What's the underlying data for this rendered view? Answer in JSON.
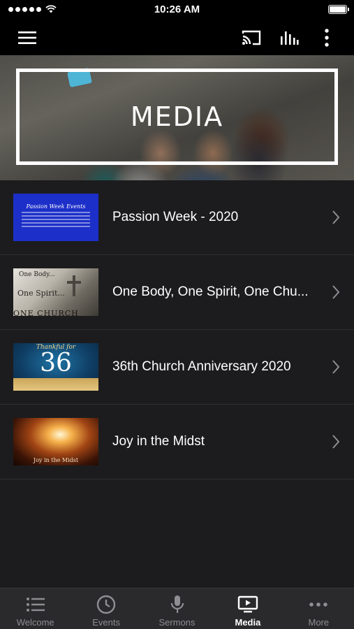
{
  "status_bar": {
    "time": "10:26 AM"
  },
  "hero": {
    "title": "MEDIA"
  },
  "media_items": [
    {
      "title": "Passion Week - 2020",
      "thumb_text": "Passion Week Events"
    },
    {
      "title": "One Body, One Spirit, One Chu...",
      "thumb_text": [
        "One Body...",
        "One Spirit...",
        "ONE CHURCH"
      ]
    },
    {
      "title": "36th Church Anniversary 2020",
      "thumb_text": [
        "Thankful for",
        "36"
      ]
    },
    {
      "title": "Joy in the Midst",
      "thumb_text": "Joy in the Midst"
    }
  ],
  "tabs": [
    {
      "label": "Welcome",
      "icon": "list-icon"
    },
    {
      "label": "Events",
      "icon": "clock-icon"
    },
    {
      "label": "Sermons",
      "icon": "microphone-icon"
    },
    {
      "label": "Media",
      "icon": "play-screen-icon",
      "active": true
    },
    {
      "label": "More",
      "icon": "more-dots-icon"
    }
  ],
  "colors": {
    "background": "#1c1c1e",
    "bar": "#000000",
    "tab_bar": "#2a2a2c",
    "inactive": "#8e8e93",
    "active": "#ffffff"
  }
}
